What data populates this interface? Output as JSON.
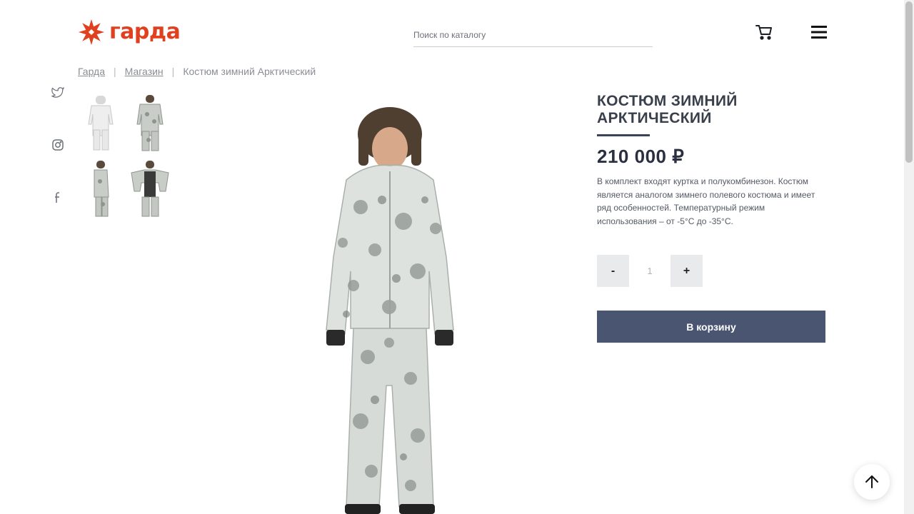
{
  "header": {
    "logo_text": "гарда",
    "search_placeholder": "Поиск по каталогу",
    "cart_icon": "cart-icon",
    "menu_icon": "hamburger-menu-icon",
    "brand_color": "#e0401f"
  },
  "breadcrumb": {
    "items": [
      "Гарда",
      "Магазин"
    ],
    "separator": "|",
    "current": "Костюм зимний Арктический"
  },
  "social": {
    "icons": [
      "twitter-icon",
      "instagram-icon",
      "facebook-icon"
    ]
  },
  "product": {
    "title": "Костюм зимний Арктический",
    "price": "210 000 ₽",
    "description": "В комплект входят куртка и полукомбинезон. Костюм является аналогом зимнего полевого костюма и имеет ряд особенностей. Температурный режим использования – от -5°С до -35°С.",
    "quantity": "1",
    "minus_label": "-",
    "plus_label": "+",
    "add_to_cart_label": "В корзину",
    "accent_color": "#4a5572"
  },
  "back_to_top_icon": "arrow-up-icon"
}
